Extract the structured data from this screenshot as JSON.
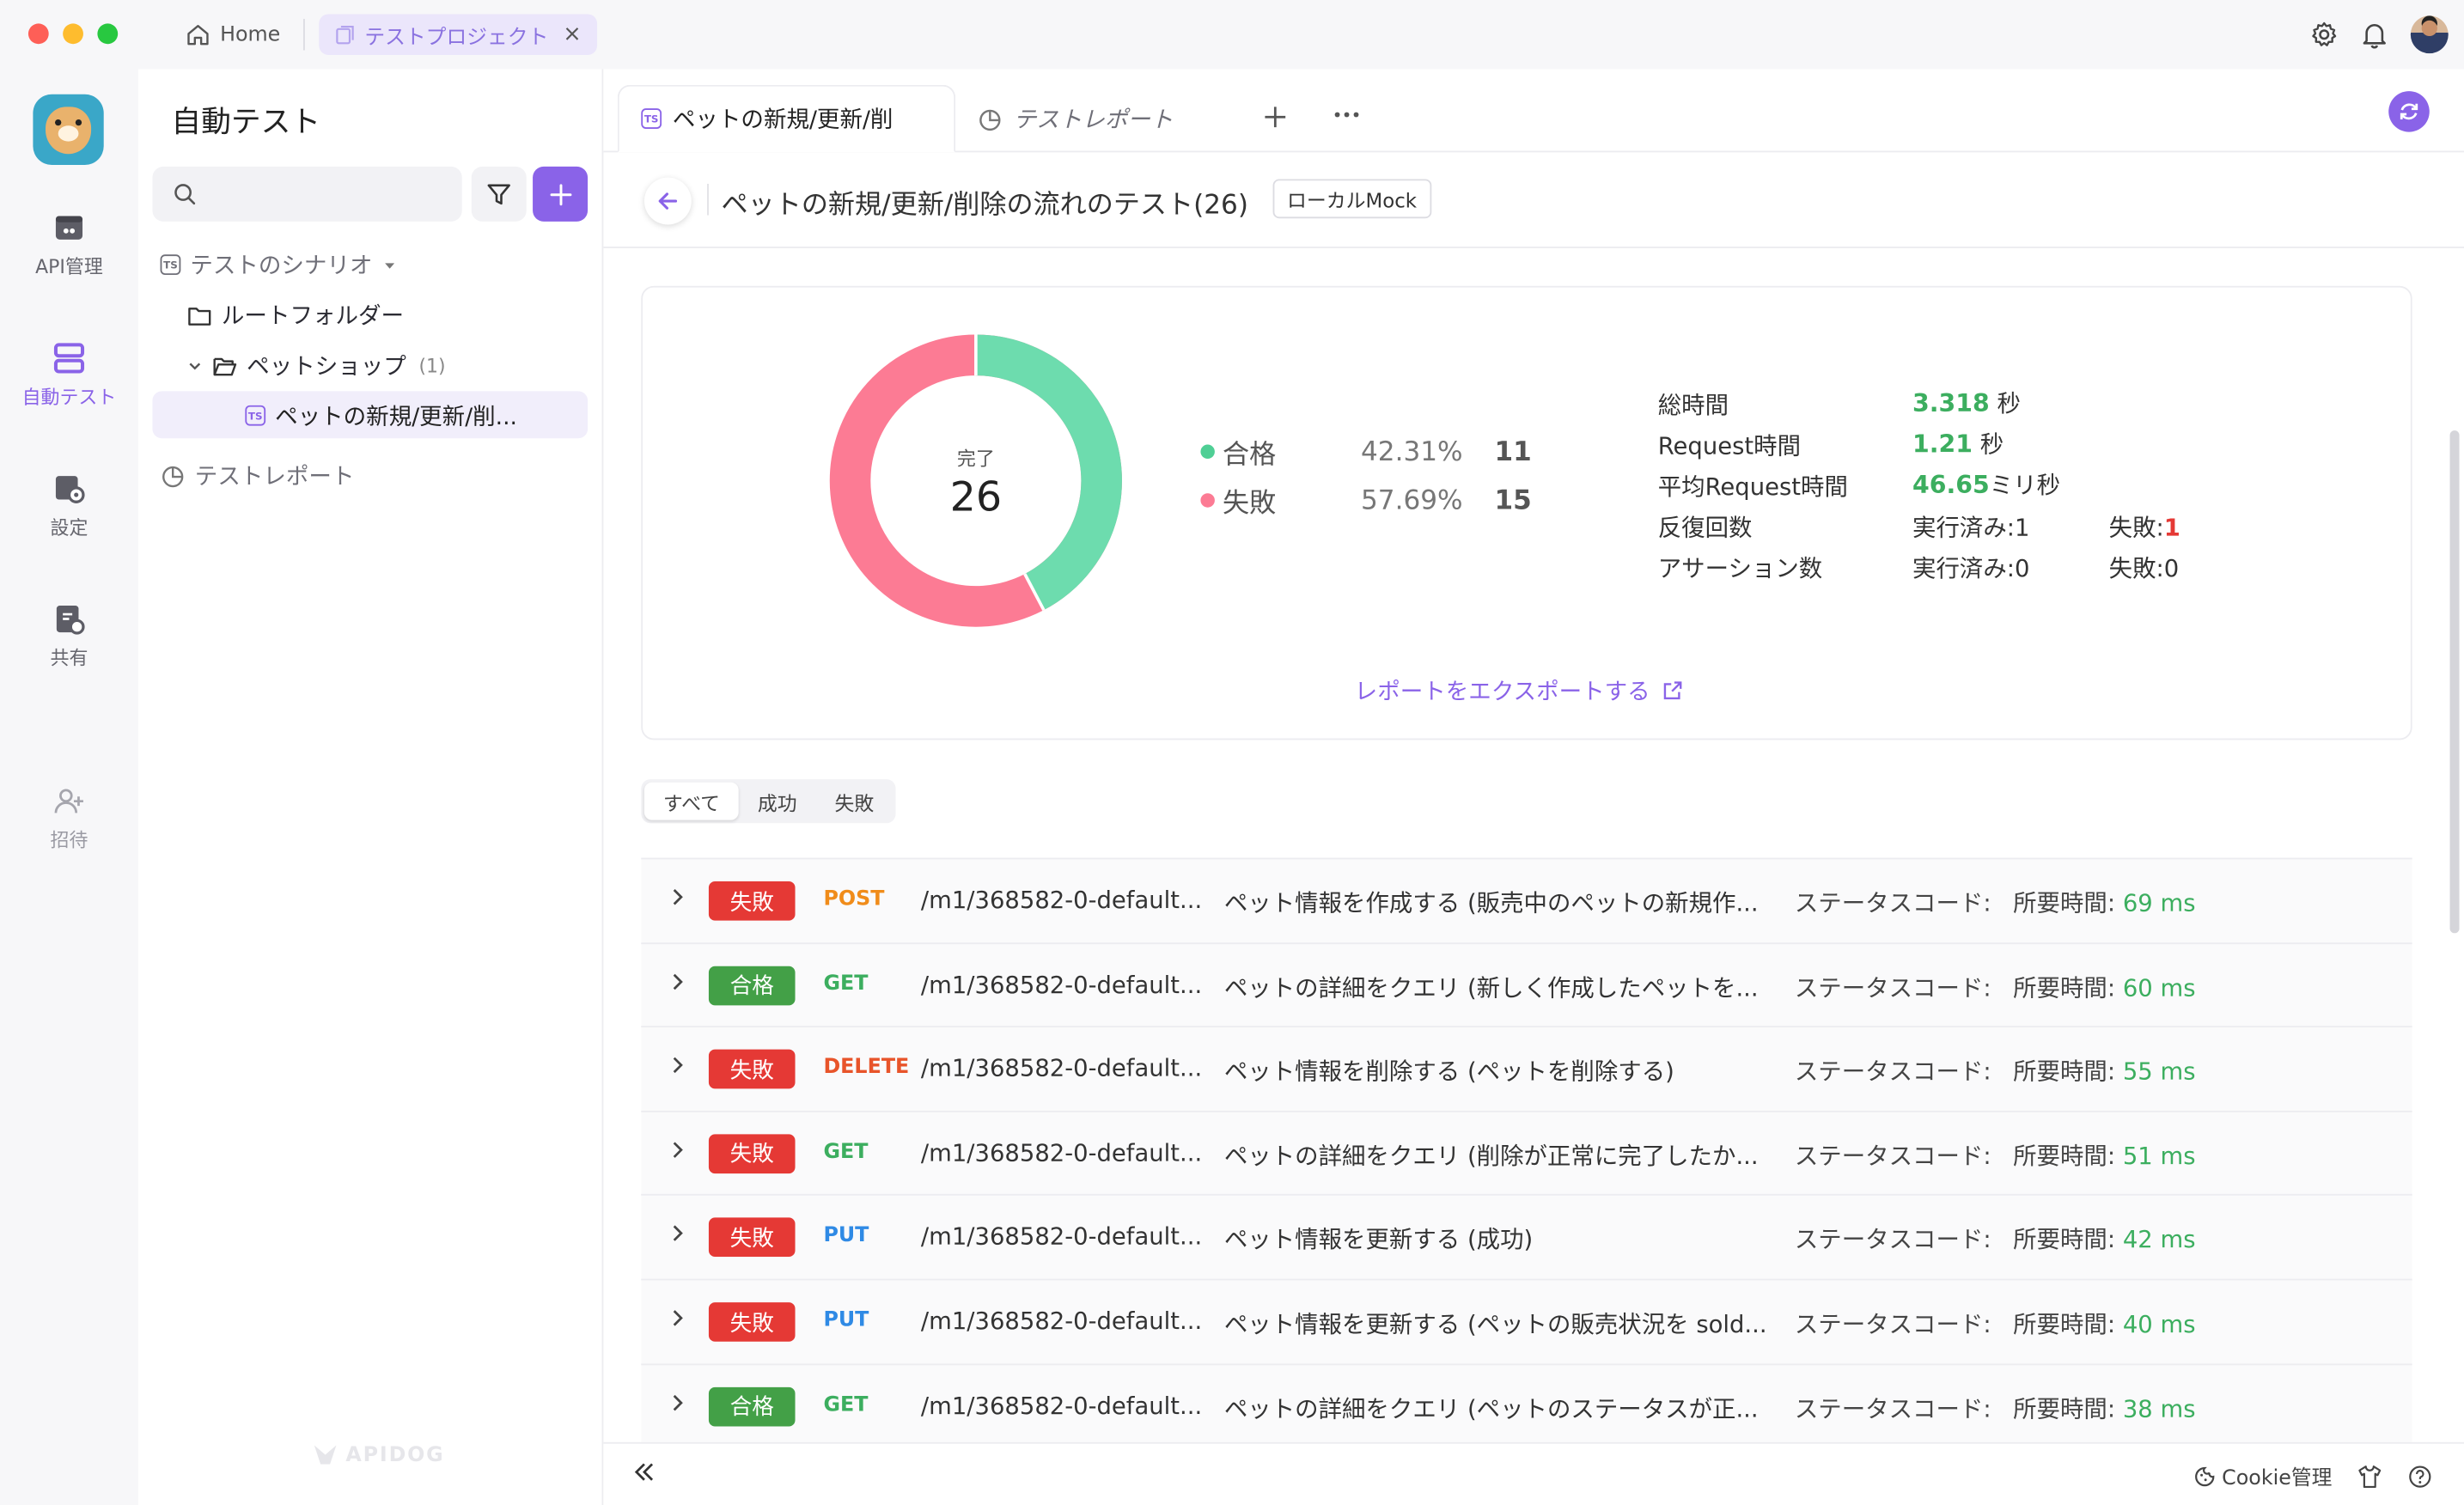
{
  "titlebar": {
    "home_label": "Home",
    "project_tab_label": "テストプロジェクト",
    "close_glyph": "×"
  },
  "rail": {
    "items": [
      {
        "label": "API管理",
        "icon": "api-icon"
      },
      {
        "label": "自動テスト",
        "icon": "auto-test-icon"
      },
      {
        "label": "設定",
        "icon": "settings-icon"
      },
      {
        "label": "共有",
        "icon": "share-icon"
      },
      {
        "label": "招待",
        "icon": "invite-icon"
      }
    ]
  },
  "sidebar": {
    "title": "自動テスト",
    "search_placeholder": "",
    "tree": {
      "scenarios_label": "テストのシナリオ",
      "root_folder": "ルートフォルダー",
      "pet_shop_folder": "ペットショップ",
      "pet_shop_count": "(1)",
      "selected_item": "ペットの新規/更新/削...",
      "reports_label": "テストレポート"
    },
    "watermark": "APIDOG"
  },
  "main": {
    "tabs": [
      {
        "label": "ペットの新規/更新/削"
      },
      {
        "label": "テストレポート"
      }
    ],
    "header": {
      "title": "ペットの新規/更新/削除の流れのテスト(26)",
      "env_badge": "ローカルMock"
    },
    "summary": {
      "center_label": "完了",
      "center_total": "26",
      "pass": {
        "label": "合格",
        "percent": "42.31%",
        "count": "11",
        "color": "#6ddcae"
      },
      "fail": {
        "label": "失敗",
        "percent": "57.69%",
        "count": "15",
        "color": "#fc7b94"
      },
      "stats": {
        "total_time_label": "総時間",
        "total_time_value": "3.318",
        "total_time_unit": "秒",
        "request_time_label": "Request時間",
        "request_time_value": "1.21",
        "request_time_unit": "秒",
        "avg_request_label": "平均Request時間",
        "avg_request_value": "46.65",
        "avg_request_unit": "ミリ秒",
        "iterations_label": "反復回数",
        "iterations_executed": "実行済み:1",
        "iterations_failed_label": "失敗:",
        "iterations_failed_value": "1",
        "assertions_label": "アサーション数",
        "assertions_executed": "実行済み:0",
        "assertions_failed": "失敗:0"
      },
      "export_label": "レポートをエクスポートする"
    },
    "filter": {
      "all": "すべて",
      "success": "成功",
      "failed": "失敗"
    },
    "status_code_label": "ステータスコード:",
    "time_label": "所要時間:",
    "results": [
      {
        "status": "失敗",
        "method": "POST",
        "path": "/m1/368582-0-default...",
        "desc": "ペット情報を作成する (販売中のペットの新規作...",
        "time": "69 ms"
      },
      {
        "status": "合格",
        "method": "GET",
        "path": "/m1/368582-0-default...",
        "desc": "ペットの詳細をクエリ (新しく作成したペットを...",
        "time": "60 ms"
      },
      {
        "status": "失敗",
        "method": "DELETE",
        "path": "/m1/368582-0-default...",
        "desc": "ペット情報を削除する (ペットを削除する)",
        "time": "55 ms"
      },
      {
        "status": "失敗",
        "method": "GET",
        "path": "/m1/368582-0-default...",
        "desc": "ペットの詳細をクエリ (削除が正常に完了したか...",
        "time": "51 ms"
      },
      {
        "status": "失敗",
        "method": "PUT",
        "path": "/m1/368582-0-default...",
        "desc": "ペット情報を更新する (成功)",
        "time": "42 ms"
      },
      {
        "status": "失敗",
        "method": "PUT",
        "path": "/m1/368582-0-default...",
        "desc": "ペット情報を更新する (ペットの販売状況を sold...",
        "time": "40 ms"
      },
      {
        "status": "合格",
        "method": "GET",
        "path": "/m1/368582-0-default...",
        "desc": "ペットの詳細をクエリ (ペットのステータスが正...",
        "time": "38 ms"
      }
    ],
    "colors": {
      "accent": "#8a63e8",
      "pass_badge": "#43a047",
      "fail_badge": "#e53935",
      "method_post": "#f08c1a",
      "method_get": "#3cae5f",
      "method_delete": "#e8542a",
      "method_put": "#2f8ae5"
    }
  },
  "bottom_bar": {
    "cookie_label": "Cookie管理"
  }
}
